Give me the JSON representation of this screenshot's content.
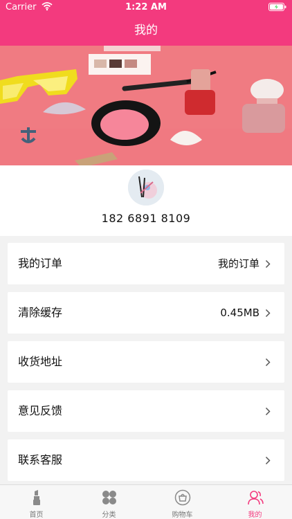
{
  "status_bar": {
    "carrier": "Carrier",
    "time": "1:22 AM"
  },
  "nav": {
    "title": "我的"
  },
  "profile": {
    "phone": "182 6891 8109"
  },
  "menu": [
    {
      "label": "我的订单",
      "value": "我的订单"
    },
    {
      "label": "清除缓存",
      "value": "0.45MB"
    },
    {
      "label": "收货地址",
      "value": ""
    },
    {
      "label": "意见反馈",
      "value": ""
    },
    {
      "label": "联系客服",
      "value": ""
    }
  ],
  "tabbar": [
    {
      "label": "首页",
      "icon": "lipstick-icon"
    },
    {
      "label": "分类",
      "icon": "category-grid-icon"
    },
    {
      "label": "购物车",
      "icon": "cart-bag-icon"
    },
    {
      "label": "我的",
      "icon": "user-icon",
      "active": true
    }
  ],
  "colors": {
    "accent": "#f33a7e",
    "banner_bg": "#f07b82",
    "page_bg": "#f2f2f2"
  }
}
